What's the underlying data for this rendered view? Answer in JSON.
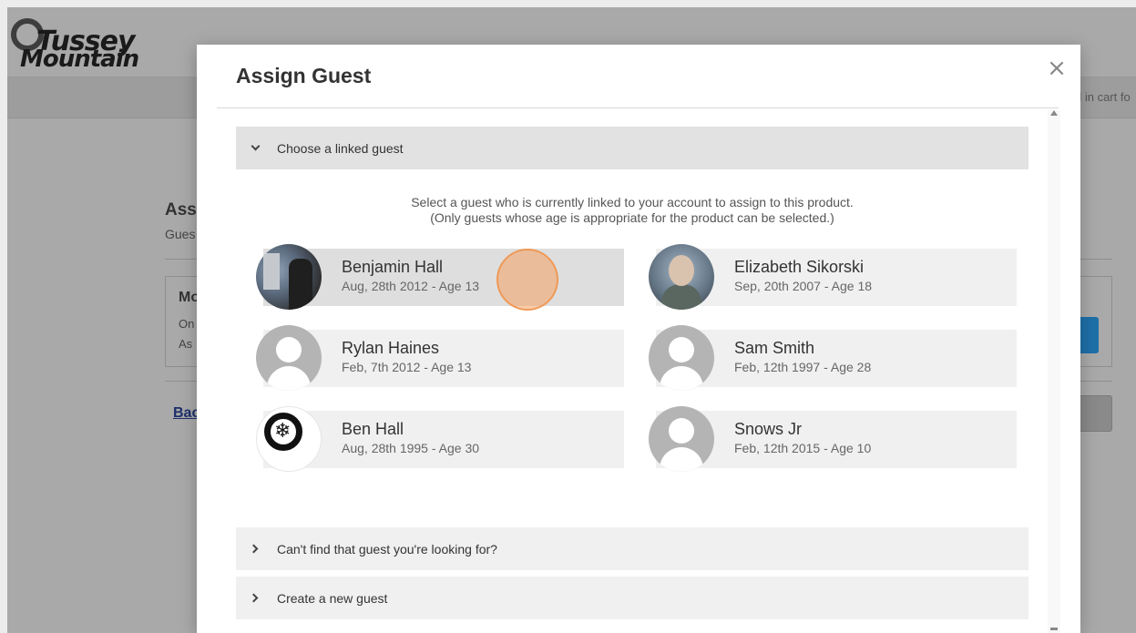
{
  "logo": {
    "line1": "Tussey",
    "line2": "Mountain"
  },
  "background": {
    "cart_text": "d in cart fo",
    "heading": "Ass",
    "sub": "Gues",
    "box_title": "Mo",
    "box_line1": "On",
    "box_line2": "As",
    "back_link": "Bac"
  },
  "modal": {
    "title": "Assign Guest",
    "close_glyph": "×",
    "linked_section": {
      "header": "Choose a linked guest",
      "intro_line1": "Select a guest who is currently linked to your account to assign to this product.",
      "intro_line2": "(Only guests whose age is appropriate for the product can be selected.)"
    },
    "guests": [
      {
        "name": "Benjamin Hall",
        "info": "Aug, 28th 2012 - Age 13"
      },
      {
        "name": "Elizabeth Sikorski",
        "info": "Sep, 20th 2007 - Age 18"
      },
      {
        "name": "Rylan Haines",
        "info": "Feb, 7th 2012 - Age 13"
      },
      {
        "name": "Sam Smith",
        "info": "Feb, 12th 1997 - Age 28"
      },
      {
        "name": "Ben Hall",
        "info": "Aug, 28th 1995 - Age 30"
      },
      {
        "name": "Snows Jr",
        "info": "Feb, 12th 2015 - Age 10"
      }
    ],
    "cant_find_header": "Can't find that guest you're looking for?",
    "create_header": "Create a new guest"
  },
  "colors": {
    "accent_cursor": "#f4a062",
    "brand_blue": "#1e6fa8"
  }
}
